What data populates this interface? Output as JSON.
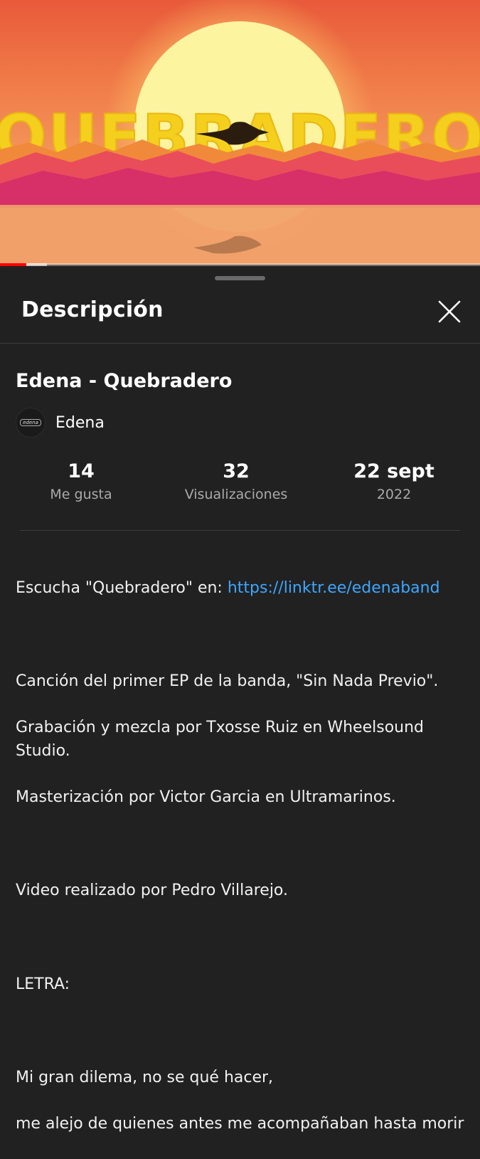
{
  "video": {
    "logo_text": "QUEBRADERO",
    "progress_fraction": 0.055,
    "buffered_fraction": 0.098
  },
  "sheet": {
    "title": "Descripción",
    "close_icon": "close-icon"
  },
  "details": {
    "video_title": "Edena - Quebradero",
    "channel_avatar_text": "edena",
    "channel_name": "Edena"
  },
  "stats": [
    {
      "value": "14",
      "label": "Me gusta"
    },
    {
      "value": "32",
      "label": "Visualizaciones"
    },
    {
      "value": "22 sept",
      "label": "2022"
    }
  ],
  "description": {
    "listen_prefix": "Escucha \"Quebradero\" en: ",
    "listen_link": "https://linktr.ee/edenaband",
    "line1": "Canción del primer EP de la banda, \"Sin Nada Previo\".",
    "line2": "Grabación y mezcla por Txosse Ruiz en Wheelsound Studio.",
    "line3": "Masterización por Victor Garcia en Ultramarinos.",
    "line4": "Video realizado por Pedro Villarejo.",
    "line5": "LETRA:",
    "lyric1": "Mi gran dilema, no se qué hacer,",
    "lyric2": "me alejo de quienes antes me acompañaban hasta morir"
  },
  "colors": {
    "background": "#212121",
    "link": "#3ea6ff",
    "progress": "#ff0000"
  }
}
